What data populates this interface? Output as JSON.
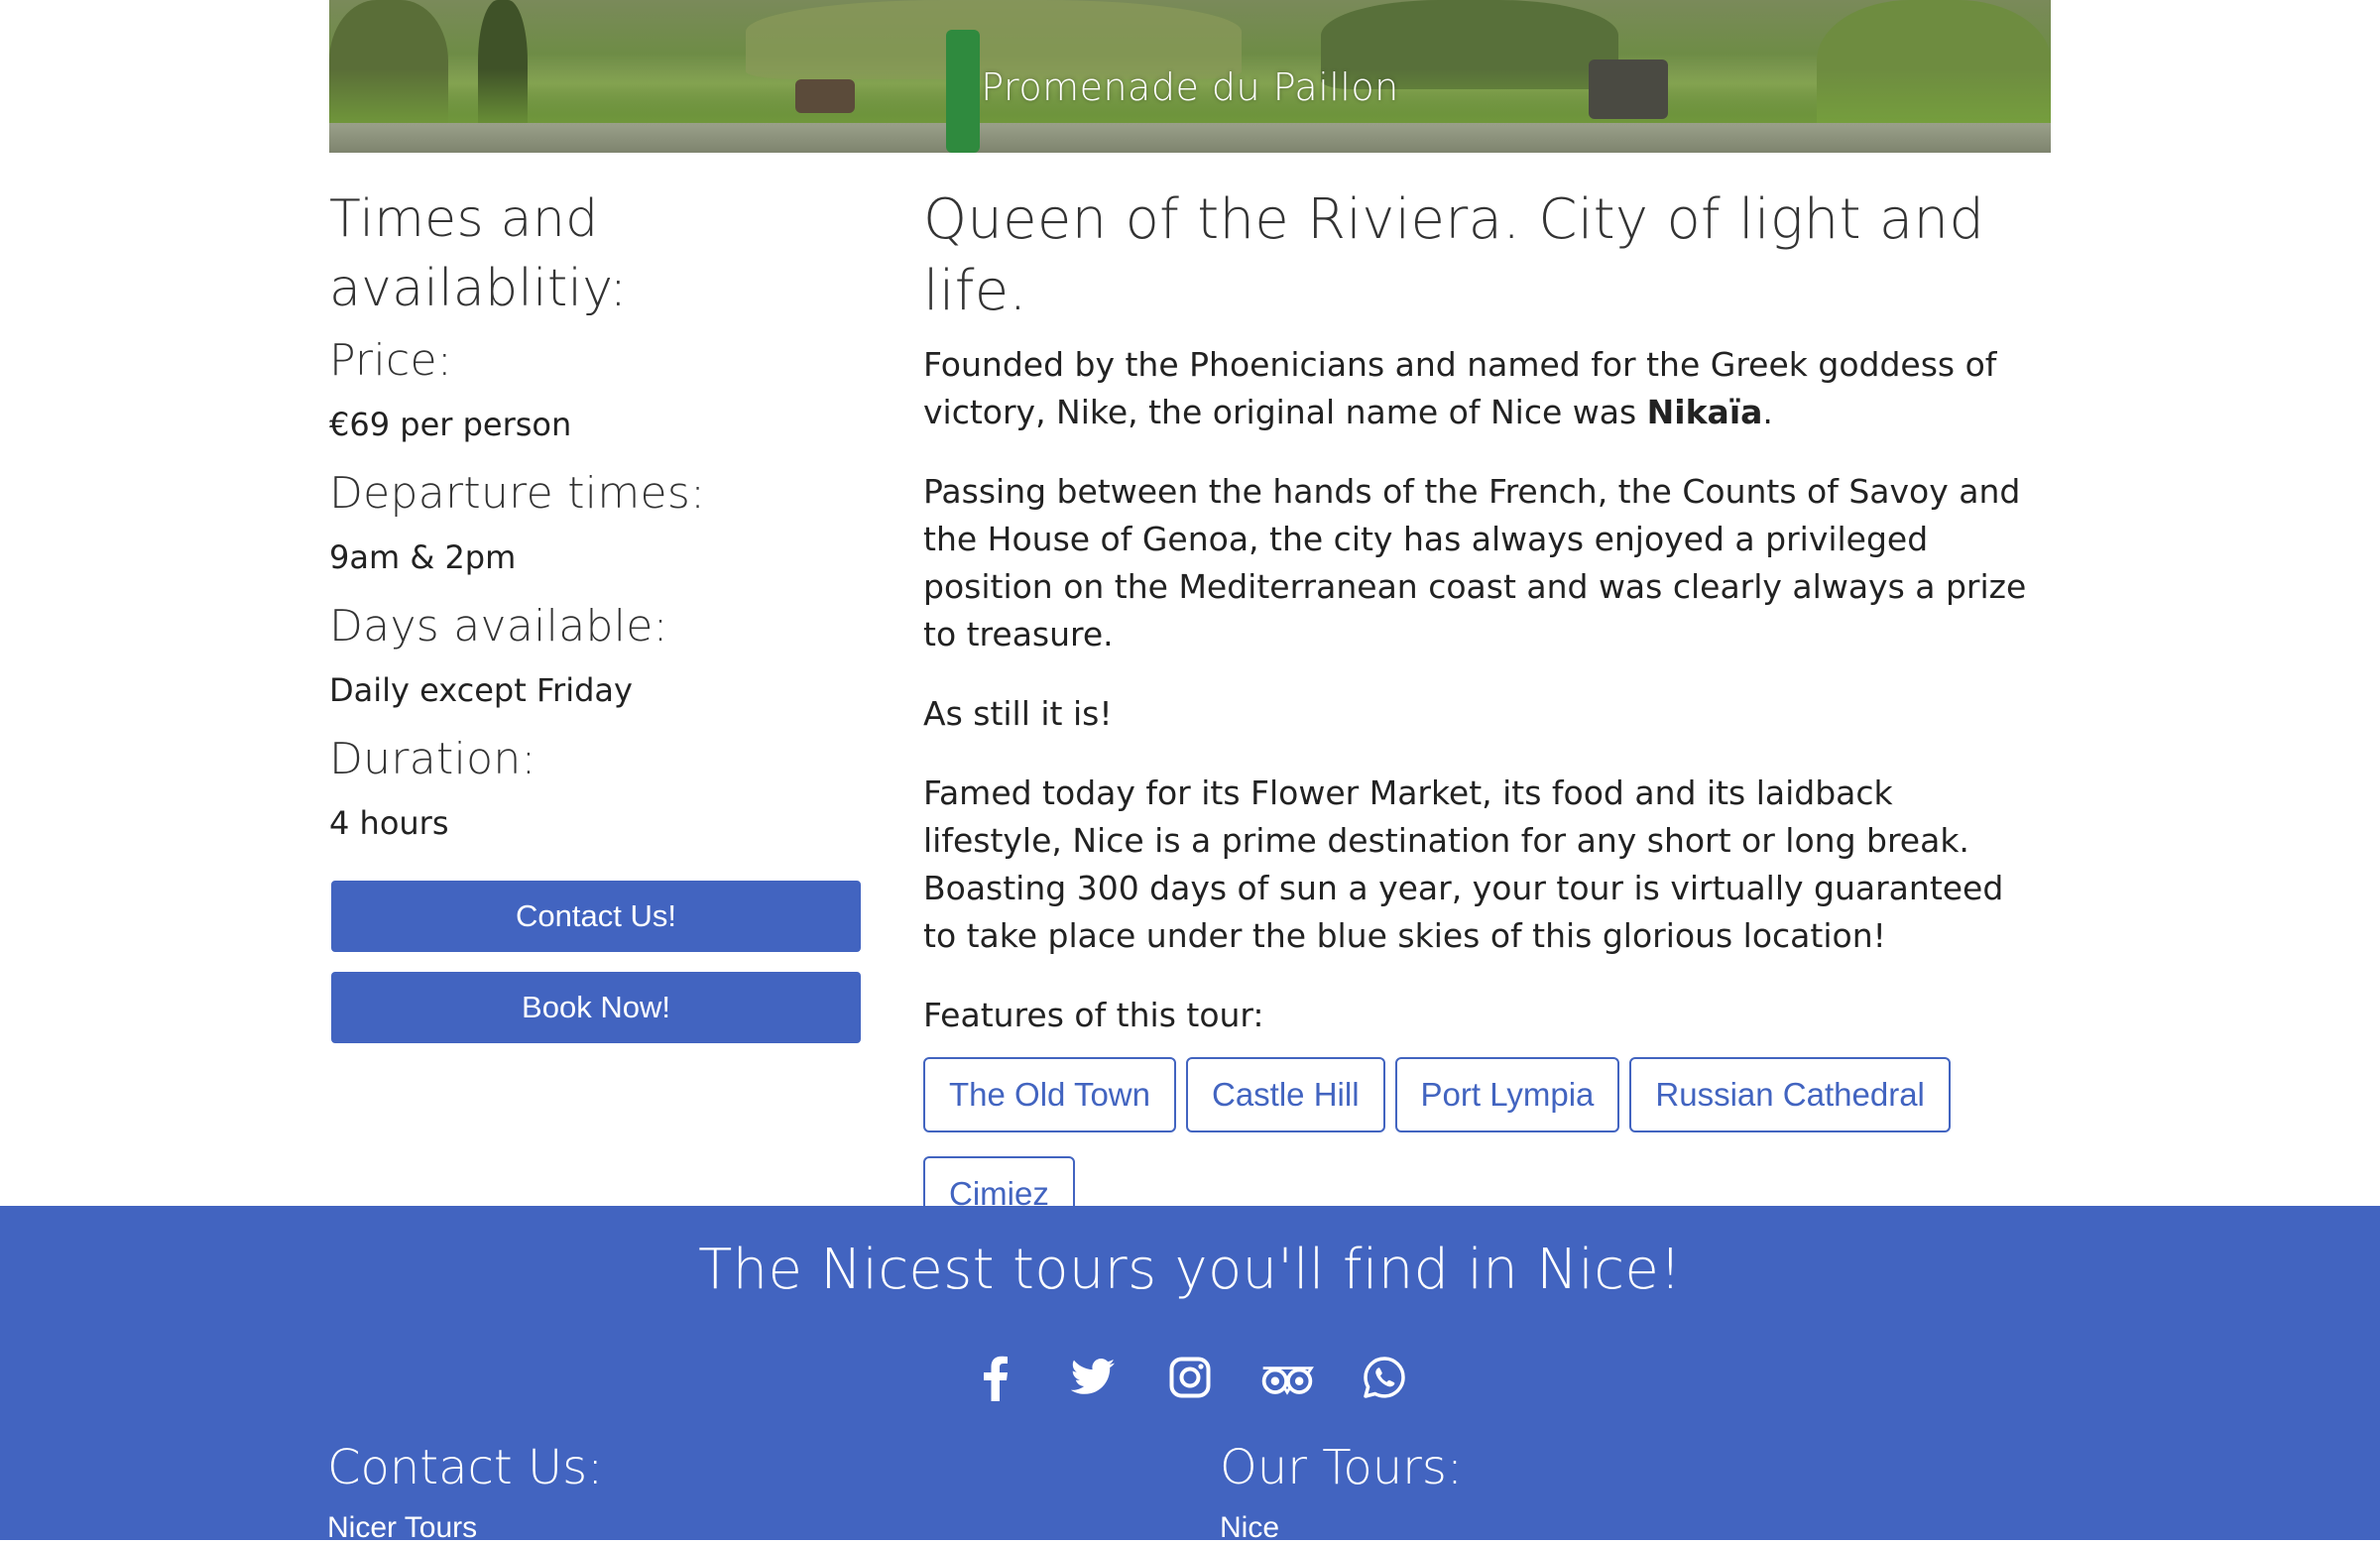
{
  "hero": {
    "caption": "Promenade du Paillon"
  },
  "sidebar": {
    "heading": "Times and availablitiy:",
    "price_label": "Price:",
    "price_value": "€69 per person",
    "departure_label": "Departure times:",
    "departure_value": "9am & 2pm",
    "days_label": "Days available:",
    "days_value": "Daily except Friday",
    "duration_label": "Duration:",
    "duration_value": "4 hours",
    "contact_button": "Contact Us!",
    "book_button": "Book Now!"
  },
  "main": {
    "title": "Queen of the Riviera. City of light and life.",
    "para1_a": "Founded by the Phoenicians and named for the Greek goddess of victory, Nike, the original name of Nice was ",
    "para1_bold": "Nikaïa",
    "para1_end": ".",
    "para2": "Passing between the hands of the French, the Counts of Savoy and the House of Genoa, the city has always enjoyed a privileged position on the Mediterranean coast and was clearly always a prize to treasure.",
    "para3": "As still it is!",
    "para4": "Famed today for its Flower Market, its food and its laidback lifestyle, Nice is a prime destination for any short or long break. Boasting 300 days of sun a year, your tour is virtually guaranteed to take place under the blue skies of this glorious location!",
    "features_label": "Features of this tour:",
    "features": [
      "The Old Town",
      "Castle Hill",
      "Port Lympia",
      "Russian Cathedral",
      "Cimiez"
    ]
  },
  "footer": {
    "title": "The Nicest tours you'll find in Nice!",
    "social_icons": [
      "facebook-icon",
      "twitter-icon",
      "instagram-icon",
      "tripadvisor-icon",
      "whatsapp-icon"
    ],
    "contact_heading": "Contact Us:",
    "contact_sub": "Nicer Tours",
    "tours_heading": "Our Tours:",
    "tours_sub": "Nice"
  },
  "colors": {
    "accent": "#4264c0",
    "text": "#222222",
    "background": "#ffffff"
  }
}
